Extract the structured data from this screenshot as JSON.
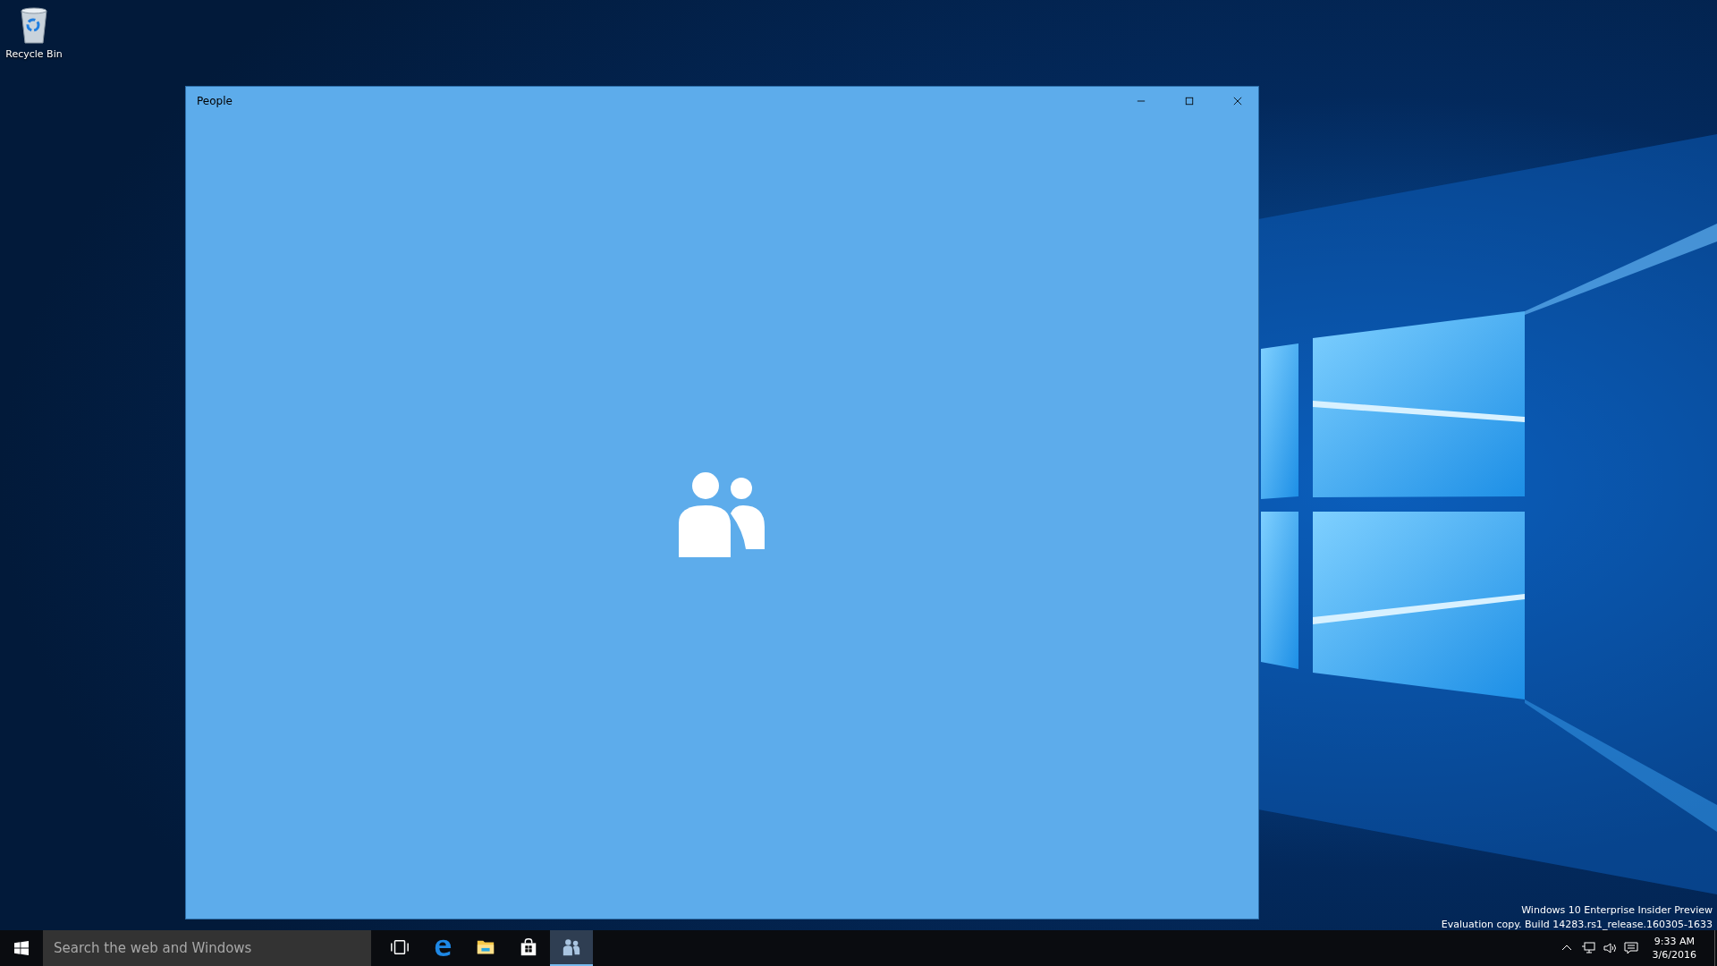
{
  "desktop_icons": [
    {
      "label": "Recycle Bin"
    }
  ],
  "window": {
    "title": "People"
  },
  "desktop_notice": [
    "Windows 10 Enterprise Insider Preview",
    "Evaluation copy. Build 14283.rs1_release.160305-1633"
  ],
  "taskbar": {
    "search": {
      "placeholder": "Search the web and Windows"
    },
    "apps": [
      {
        "kind": "task-view",
        "selected": false
      },
      {
        "kind": "edge",
        "selected": false
      },
      {
        "kind": "explorer",
        "selected": false
      },
      {
        "kind": "store",
        "selected": false
      },
      {
        "kind": "people",
        "selected": true
      }
    ],
    "clock": {
      "time": "9:33 AM",
      "date": "3/6/2016"
    }
  }
}
